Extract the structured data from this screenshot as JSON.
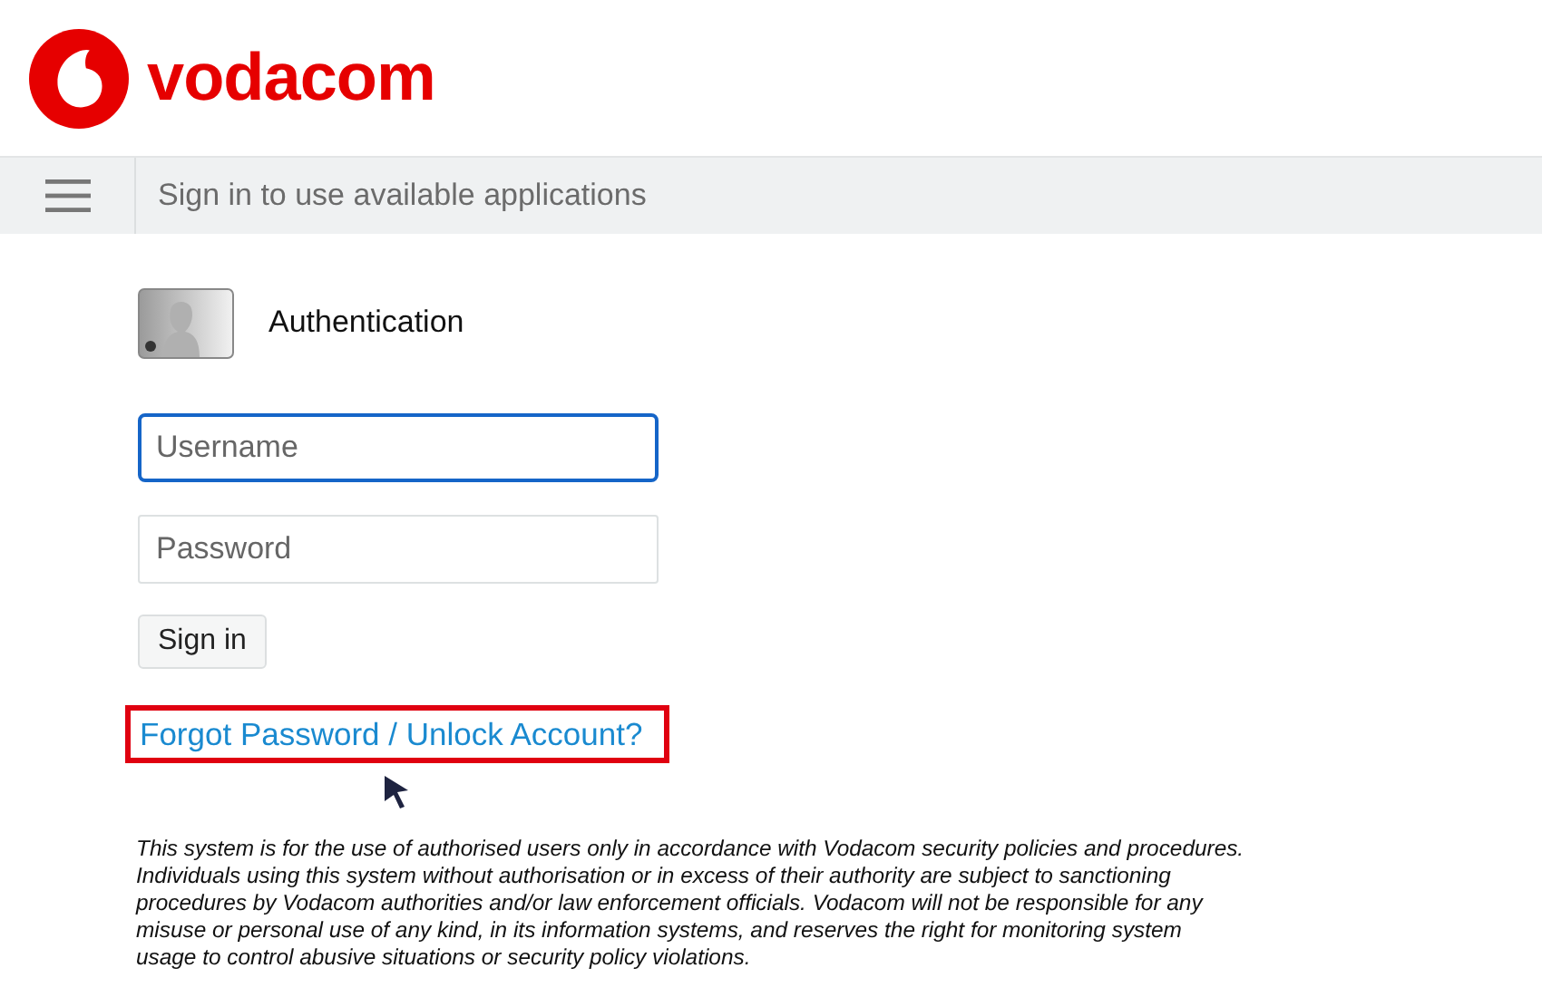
{
  "logo": {
    "text": "vodacom"
  },
  "nav_bar": {
    "title": "Sign in to use available applications"
  },
  "auth": {
    "heading": "Authentication"
  },
  "fields": [
    {
      "placeholder": "Username",
      "focused": true
    },
    {
      "placeholder": "Password",
      "focused": false
    }
  ],
  "sign_in_button": "Sign in",
  "forgot_link": {
    "text": "Forgot Password / Unlock Account?",
    "highlighted": true
  },
  "disclaimer": "This system is for the use of authorised users only in accordance with Vodacom security policies and procedures. Individuals using this system without authorisation or in excess of their authority are subject to sanctioning procedures by Vodacom authorities and/or law enforcement officials. Vodacom will not be responsible for any misuse or personal use of any kind, in its information systems, and reserves the right for monitoring system usage to control abusive situations or security policy violations."
}
